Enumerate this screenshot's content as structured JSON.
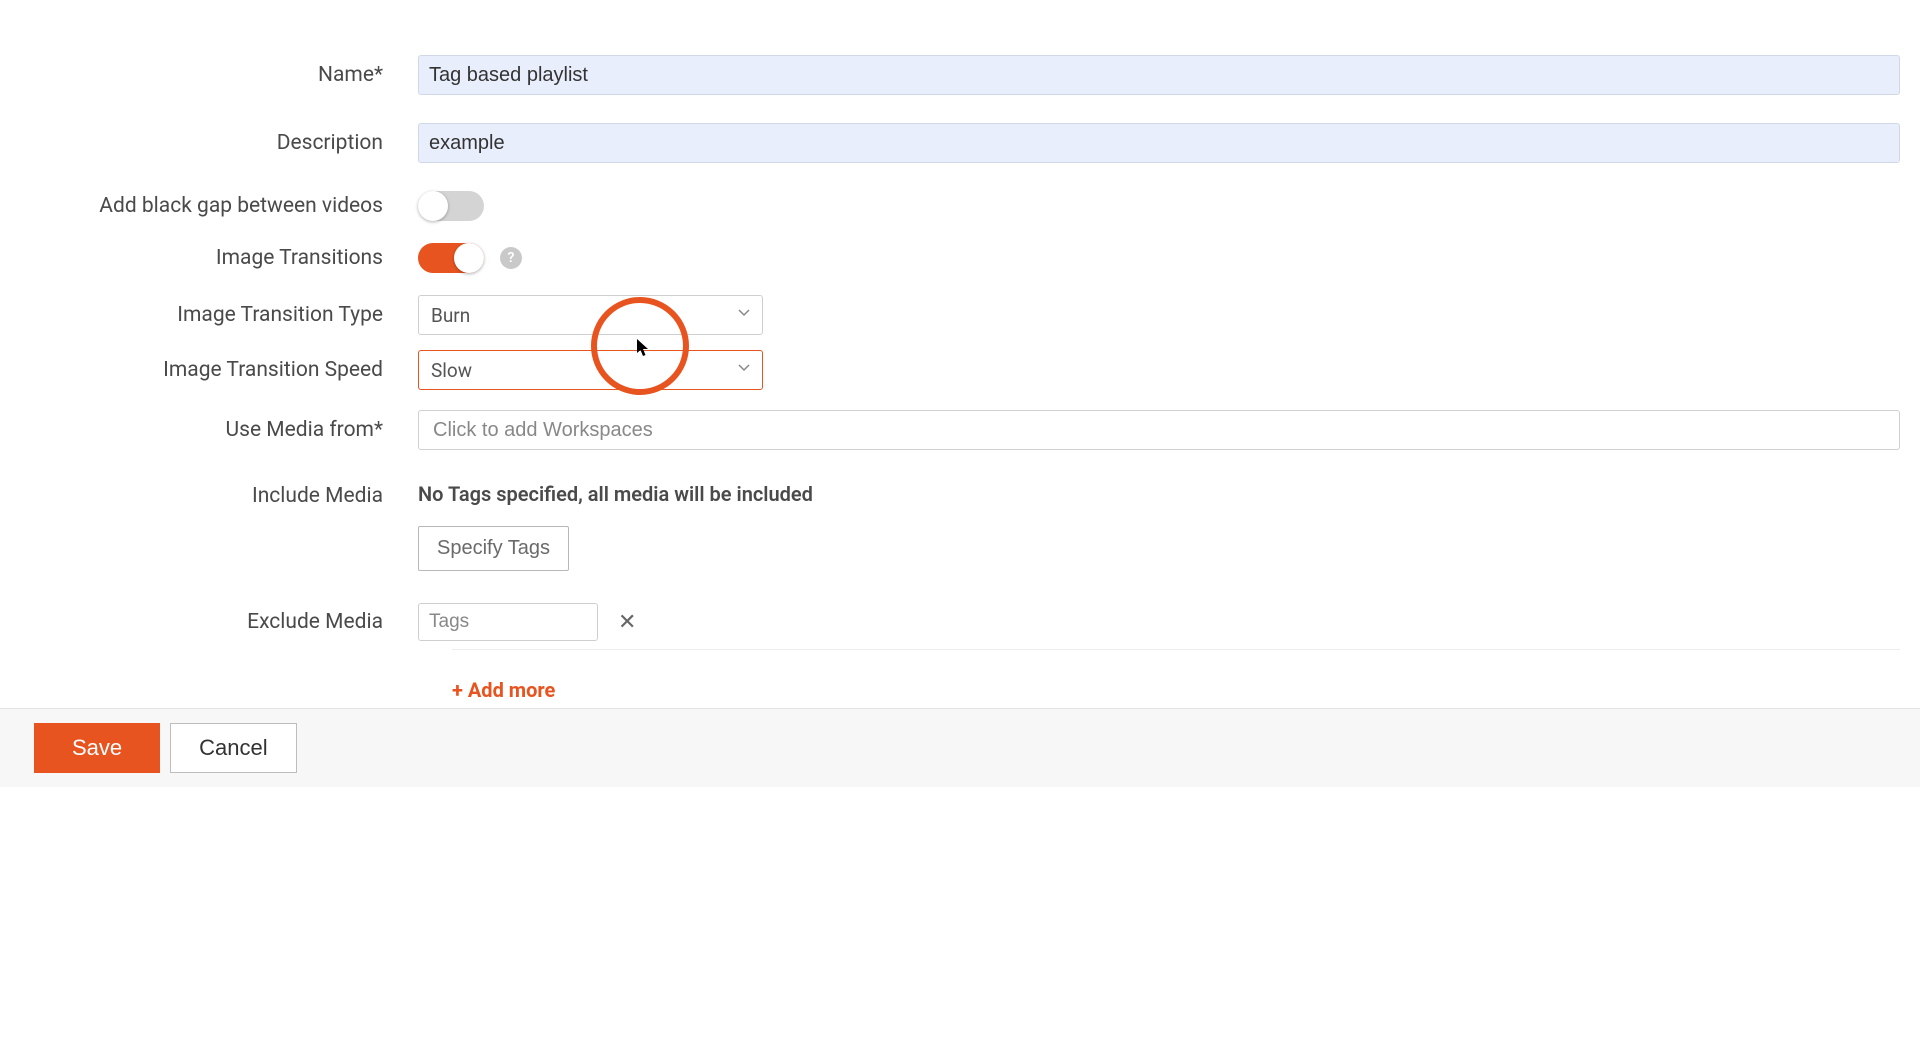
{
  "form": {
    "name_label": "Name*",
    "name_value": "Tag based playlist",
    "description_label": "Description",
    "description_value": "example",
    "black_gap_label": "Add black gap between videos",
    "transitions_label": "Image Transitions",
    "help_char": "?",
    "transition_type_label": "Image Transition Type",
    "transition_type_value": "Burn",
    "transition_speed_label": "Image Transition Speed",
    "transition_speed_value": "Slow",
    "use_media_label": "Use Media from*",
    "use_media_placeholder": "Click to add Workspaces",
    "include_label": "Include Media",
    "include_text": "No Tags specified, all media will be included",
    "specify_tags_label": "Specify Tags",
    "exclude_label": "Exclude Media",
    "exclude_placeholder": "Tags",
    "close_char": "✕",
    "add_more_label": "+ Add more"
  },
  "footer": {
    "save_label": "Save",
    "cancel_label": "Cancel"
  }
}
